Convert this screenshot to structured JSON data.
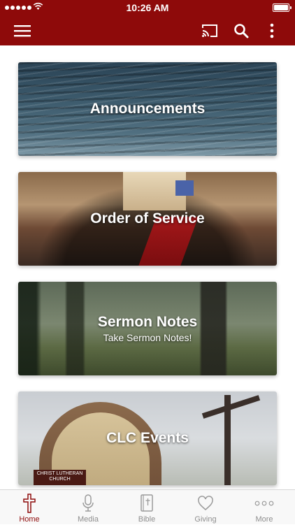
{
  "status_bar": {
    "time": "10:26 AM"
  },
  "app_bar": {
    "menu_icon": "hamburger-menu-icon",
    "cast_icon": "cast-icon",
    "search_icon": "search-icon",
    "more_icon": "more-vertical-icon"
  },
  "cards": [
    {
      "title": "Announcements",
      "subtitle": ""
    },
    {
      "title": "Order of Service",
      "subtitle": ""
    },
    {
      "title": "Sermon Notes",
      "subtitle": "Take Sermon Notes!"
    },
    {
      "title": "CLC Events",
      "subtitle": "",
      "sign_text": "CHRIST LUTHERAN CHURCH"
    }
  ],
  "tabs": [
    {
      "label": "Home",
      "icon": "cross-icon",
      "active": true
    },
    {
      "label": "Media",
      "icon": "microphone-icon",
      "active": false
    },
    {
      "label": "Bible",
      "icon": "bible-icon",
      "active": false
    },
    {
      "label": "Giving",
      "icon": "heart-icon",
      "active": false
    },
    {
      "label": "More",
      "icon": "more-dots-icon",
      "active": false
    }
  ],
  "colors": {
    "brand": "#8e0a0a",
    "tab_inactive": "#8e8e8e",
    "tab_active": "#8e0a0a"
  }
}
